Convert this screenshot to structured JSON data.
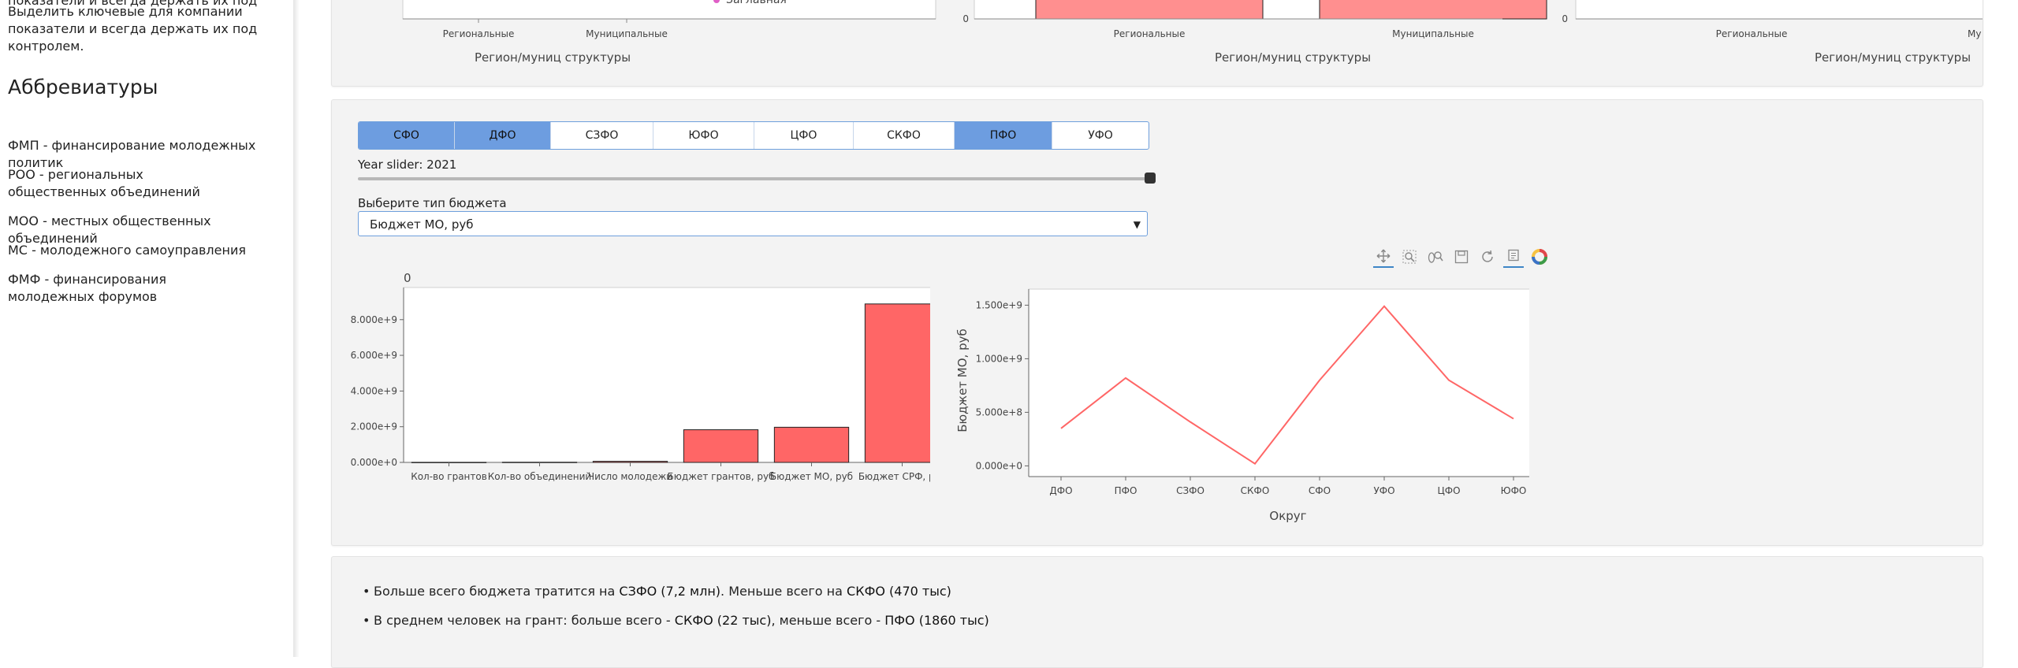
{
  "sidebar": {
    "partial_line": "показатели и всегда держать их под",
    "intro_lines": [
      "Выделить ключевые для компании",
      "показатели и всегда держать их под",
      "контролем."
    ],
    "abbr_heading": "Аббревиатуры",
    "abbreviations": [
      "ФМП - финансирование молодежных политик",
      "РОО - региональных общественных объединений",
      "МОО - местных общественных объединений",
      "МС - молодежного самоуправления",
      "ФМФ - финансирования молодежных форумов"
    ]
  },
  "top_card": {
    "charts": [
      {
        "tick_labels": [
          "Региональные",
          "Муниципальные"
        ],
        "xlabel": "Регион/муниц структуры",
        "legend_item": "Заглавная",
        "zero_label": ""
      },
      {
        "tick_labels": [
          "Региональные",
          "Муниципальные"
        ],
        "xlabel": "Регион/муниц структуры",
        "zero_label": "0"
      },
      {
        "tick_labels": [
          "Региональные",
          "Му"
        ],
        "xlabel": "Регион/муниц структуры",
        "zero_label": "0"
      }
    ]
  },
  "controls": {
    "tabs": [
      {
        "label": "СФО",
        "active": true
      },
      {
        "label": "ДФО",
        "active": true
      },
      {
        "label": "СЗФО",
        "active": false
      },
      {
        "label": "ЮФО",
        "active": false
      },
      {
        "label": "ЦФО",
        "active": false
      },
      {
        "label": "СКФО",
        "active": false
      },
      {
        "label": "ПФО",
        "active": true
      },
      {
        "label": "УФО",
        "active": false
      }
    ],
    "slider_label": "Year slider: 2021",
    "slider_value": 1.0,
    "select_label": "Выберите тип бюджета",
    "select_value": "Бюджет МО, руб"
  },
  "toolbar": {
    "icons": [
      "pan-icon",
      "box-zoom-icon",
      "wheel-zoom-icon",
      "save-icon",
      "reset-icon",
      "hover-icon",
      "bokeh-logo-icon"
    ]
  },
  "chart_data": [
    {
      "type": "bar",
      "title": "0",
      "categories": [
        "Кол-во грантов",
        "Кол-во объединений",
        "Число молодежи",
        "Бюджет грантов, руб",
        "Бюджет МО, руб",
        "Бюджет СРФ, руб"
      ],
      "values": [
        5000000,
        10000000,
        60000000,
        1830000000,
        1970000000,
        8880000000
      ],
      "ylim": [
        0,
        9800000000
      ],
      "yticks": [
        "0.000e+0",
        "2.000e+9",
        "4.000e+9",
        "6.000e+9",
        "8.000e+9"
      ],
      "ytick_values": [
        0,
        2000000000,
        4000000000,
        6000000000,
        8000000000
      ],
      "color": "#ff6666"
    },
    {
      "type": "line",
      "categories": [
        "ДФО",
        "ПФО",
        "СЗФО",
        "СКФО",
        "СФО",
        "УФО",
        "ЦФО",
        "ЮФО"
      ],
      "values": [
        350000000,
        820000000,
        410000000,
        20000000,
        800000000,
        1490000000,
        800000000,
        440000000
      ],
      "ylim": [
        -100000000,
        1650000000
      ],
      "yticks": [
        "0.000e+0",
        "5.000e+8",
        "1.000e+9",
        "1.500e+9"
      ],
      "ytick_values": [
        0,
        500000000,
        1000000000,
        1500000000
      ],
      "ylabel": "Бюджет МО, руб",
      "xlabel": "Округ",
      "color": "#ff6666"
    }
  ],
  "insights": {
    "line1_pre": "Больше всего бюджета тратится на ",
    "line1_b1": "СЗФО (7,2 млн)",
    "line1_mid": ". Меньше всего на ",
    "line1_b2": "СКФО (470 тыс)",
    "line2_pre": "В среднем человек на грант: больше всего - ",
    "line2_b1": "СКФО (22 тыс)",
    "line2_mid": ", меньше всего - ",
    "line2_b2": "ПФО (1860 тыс)"
  }
}
